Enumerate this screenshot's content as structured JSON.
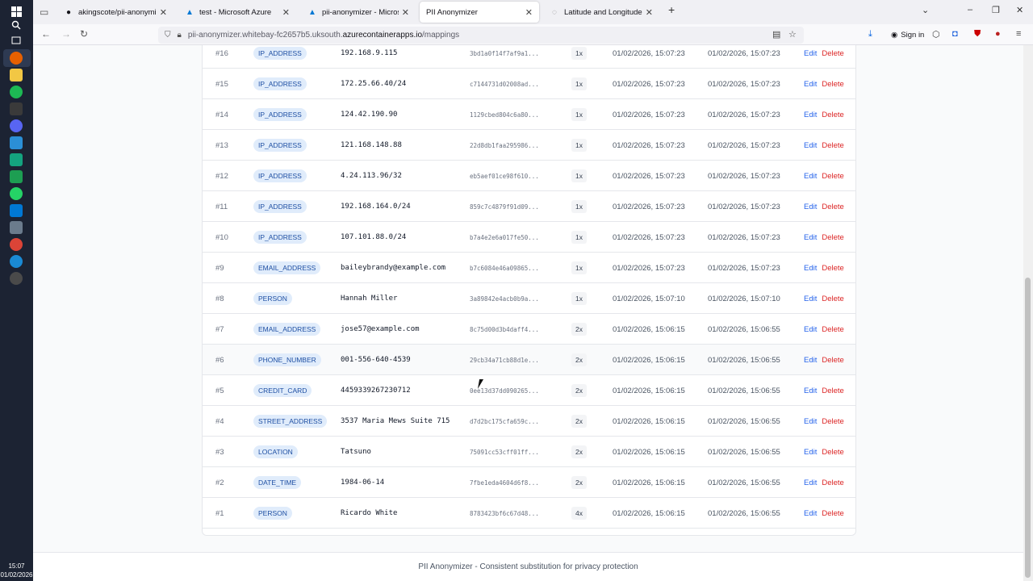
{
  "browser": {
    "tabs": [
      {
        "title": "akingscote/pii-anonymizer-serv",
        "icon": "github-icon"
      },
      {
        "title": "test - Microsoft Azure",
        "icon": "azure-icon"
      },
      {
        "title": "pii-anonymizer - Microsoft Azu",
        "icon": "azure-icon"
      },
      {
        "title": "PII Anonymizer",
        "icon": "none"
      },
      {
        "title": "Latitude and Longitude Finder o",
        "icon": "globe-icon"
      }
    ],
    "url_prefix": "pii-anonymizer.whitebay-fc2657b5.uksouth.",
    "url_host": "azurecontainerapps.io",
    "url_path": "/mappings",
    "sign_in_label": "Sign in"
  },
  "taskbar": {
    "time": "15:07",
    "date": "01/02/2026"
  },
  "table": {
    "edit_label": "Edit",
    "delete_label": "Delete",
    "rows": [
      {
        "id": "#16",
        "type": "IP_ADDRESS",
        "value": "192.168.9.115",
        "hash": "3bd1a0f14f7af9a1...",
        "count": "1x",
        "created": "01/02/2026, 15:07:23",
        "updated": "01/02/2026, 15:07:23"
      },
      {
        "id": "#15",
        "type": "IP_ADDRESS",
        "value": "172.25.66.40/24",
        "hash": "c7144731d02008ad...",
        "count": "1x",
        "created": "01/02/2026, 15:07:23",
        "updated": "01/02/2026, 15:07:23"
      },
      {
        "id": "#14",
        "type": "IP_ADDRESS",
        "value": "124.42.190.90",
        "hash": "1129cbed804c6a80...",
        "count": "1x",
        "created": "01/02/2026, 15:07:23",
        "updated": "01/02/2026, 15:07:23"
      },
      {
        "id": "#13",
        "type": "IP_ADDRESS",
        "value": "121.168.148.88",
        "hash": "22d8db1faa295986...",
        "count": "1x",
        "created": "01/02/2026, 15:07:23",
        "updated": "01/02/2026, 15:07:23"
      },
      {
        "id": "#12",
        "type": "IP_ADDRESS",
        "value": "4.24.113.96/32",
        "hash": "eb5aef01ce98f610...",
        "count": "1x",
        "created": "01/02/2026, 15:07:23",
        "updated": "01/02/2026, 15:07:23"
      },
      {
        "id": "#11",
        "type": "IP_ADDRESS",
        "value": "192.168.164.0/24",
        "hash": "859c7c4879f91d09...",
        "count": "1x",
        "created": "01/02/2026, 15:07:23",
        "updated": "01/02/2026, 15:07:23"
      },
      {
        "id": "#10",
        "type": "IP_ADDRESS",
        "value": "107.101.88.0/24",
        "hash": "b7a4e2e6a017fe50...",
        "count": "1x",
        "created": "01/02/2026, 15:07:23",
        "updated": "01/02/2026, 15:07:23"
      },
      {
        "id": "#9",
        "type": "EMAIL_ADDRESS",
        "value": "baileybrandy@example.com",
        "hash": "b7c6084e46a09865...",
        "count": "1x",
        "created": "01/02/2026, 15:07:23",
        "updated": "01/02/2026, 15:07:23"
      },
      {
        "id": "#8",
        "type": "PERSON",
        "value": "Hannah Miller",
        "hash": "3a89842e4acb0b9a...",
        "count": "1x",
        "created": "01/02/2026, 15:07:10",
        "updated": "01/02/2026, 15:07:10"
      },
      {
        "id": "#7",
        "type": "EMAIL_ADDRESS",
        "value": "jose57@example.com",
        "hash": "8c75d00d3b4daff4...",
        "count": "2x",
        "created": "01/02/2026, 15:06:15",
        "updated": "01/02/2026, 15:06:55"
      },
      {
        "id": "#6",
        "type": "PHONE_NUMBER",
        "value": "001-556-640-4539",
        "hash": "29cb34a71cb88d1e...",
        "count": "2x",
        "created": "01/02/2026, 15:06:15",
        "updated": "01/02/2026, 15:06:55"
      },
      {
        "id": "#5",
        "type": "CREDIT_CARD",
        "value": "4459339267230712",
        "hash": "0ee13d37dd090265...",
        "count": "2x",
        "created": "01/02/2026, 15:06:15",
        "updated": "01/02/2026, 15:06:55"
      },
      {
        "id": "#4",
        "type": "STREET_ADDRESS",
        "value": "3537 Maria Mews Suite 715",
        "hash": "d7d2bc175cfa659c...",
        "count": "2x",
        "created": "01/02/2026, 15:06:15",
        "updated": "01/02/2026, 15:06:55"
      },
      {
        "id": "#3",
        "type": "LOCATION",
        "value": "Tatsuno",
        "hash": "75091cc53cff01ff...",
        "count": "2x",
        "created": "01/02/2026, 15:06:15",
        "updated": "01/02/2026, 15:06:55"
      },
      {
        "id": "#2",
        "type": "DATE_TIME",
        "value": "1984-06-14",
        "hash": "7fbe1eda4604d6f8...",
        "count": "2x",
        "created": "01/02/2026, 15:06:15",
        "updated": "01/02/2026, 15:06:55"
      },
      {
        "id": "#1",
        "type": "PERSON",
        "value": "Ricardo White",
        "hash": "8783423bf6c67d48...",
        "count": "4x",
        "created": "01/02/2026, 15:06:15",
        "updated": "01/02/2026, 15:06:55"
      }
    ]
  },
  "footer": {
    "text": "PII Anonymizer - Consistent substitution for privacy protection"
  },
  "colors": {
    "badge_bg": "#e0ecfb",
    "badge_text": "#1e4fa3",
    "edit_link": "#2563eb",
    "delete_link": "#dc2626"
  }
}
